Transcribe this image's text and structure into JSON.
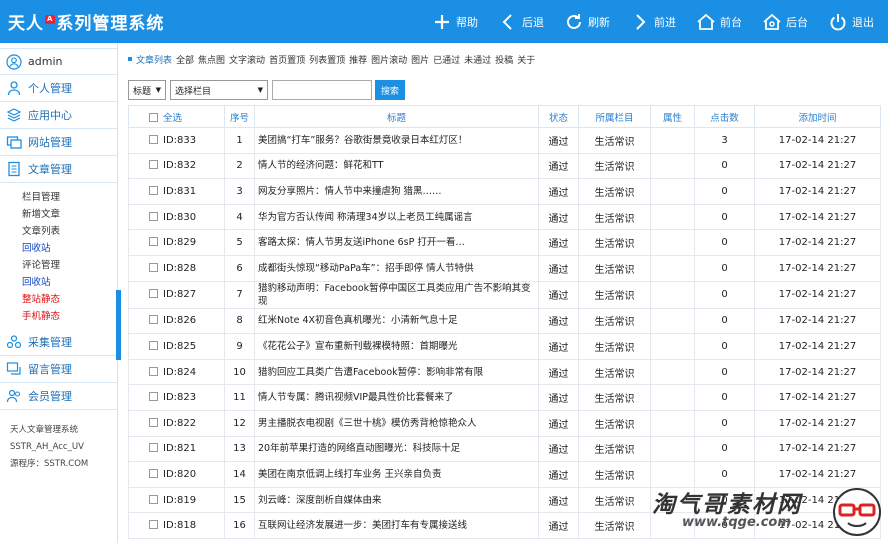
{
  "header": {
    "title": "天人系列管理系统",
    "badge": "A",
    "nav": [
      {
        "label": "帮助",
        "icon": "plus-icon"
      },
      {
        "label": "后退",
        "icon": "chevron-left-icon"
      },
      {
        "label": "刷新",
        "icon": "refresh-icon"
      },
      {
        "label": "前进",
        "icon": "chevron-right-icon"
      },
      {
        "label": "前台",
        "icon": "home-icon"
      },
      {
        "label": "后台",
        "icon": "admin-home-icon"
      },
      {
        "label": "退出",
        "icon": "power-icon"
      }
    ]
  },
  "sidebar": {
    "user": "admin",
    "groups": [
      {
        "label": "个人管理",
        "icon": "person-icon"
      },
      {
        "label": "应用中心",
        "icon": "layers-icon"
      },
      {
        "label": "网站管理",
        "icon": "windows-icon"
      },
      {
        "label": "文章管理",
        "icon": "document-icon"
      }
    ],
    "article_items": [
      {
        "label": "栏目管理",
        "color": "normal"
      },
      {
        "label": "新增文章",
        "color": "normal"
      },
      {
        "label": "文章列表",
        "color": "normal"
      },
      {
        "label": "回收站",
        "color": "blue"
      },
      {
        "label": "评论管理",
        "color": "normal"
      },
      {
        "label": "回收站",
        "color": "blue"
      },
      {
        "label": "整站静态",
        "color": "red"
      },
      {
        "label": "手机静态",
        "color": "red"
      }
    ],
    "groups2": [
      {
        "label": "采集管理",
        "icon": "collect-icon"
      },
      {
        "label": "留言管理",
        "icon": "message-icon"
      },
      {
        "label": "会员管理",
        "icon": "members-icon"
      }
    ],
    "footer": [
      "天人文章管理系统",
      "SSTR_AH_Acc_UV",
      "源程序：SSTR.COM"
    ]
  },
  "crumb": [
    "文章列表",
    "全部",
    "焦点图",
    "文字滚动",
    "首页置顶",
    "列表置顶",
    "推荐",
    "图片滚动",
    "图片",
    "已通过",
    "未通过",
    "投稿",
    "关于"
  ],
  "filters": {
    "field": "标题",
    "column": "选择栏目",
    "search_label": "搜索"
  },
  "table": {
    "headers": [
      "全选",
      "序号",
      "标题",
      "状态",
      "所属栏目",
      "属性",
      "点击数",
      "添加时间"
    ],
    "rows": [
      {
        "id": "ID:833",
        "no": "1",
        "title": "美团搞“打车”服务？谷歌街景竟收录日本红灯区！",
        "status": "通过",
        "column": "生活常识",
        "attr": "",
        "clicks": "3",
        "time": "17-02-14 21:27"
      },
      {
        "id": "ID:832",
        "no": "2",
        "title": "情人节的经济问题：鲜花和TT",
        "status": "通过",
        "column": "生活常识",
        "attr": "",
        "clicks": "0",
        "time": "17-02-14 21:27"
      },
      {
        "id": "ID:831",
        "no": "3",
        "title": "网友分享照片：情人节中来撞虐狗 猎黑……",
        "status": "通过",
        "column": "生活常识",
        "attr": "",
        "clicks": "0",
        "time": "17-02-14 21:27"
      },
      {
        "id": "ID:830",
        "no": "4",
        "title": "华为官方否认传闻 称清理34岁以上老员工纯属谣言",
        "status": "通过",
        "column": "生活常识",
        "attr": "",
        "clicks": "0",
        "time": "17-02-14 21:27"
      },
      {
        "id": "ID:829",
        "no": "5",
        "title": "客路太探：情人节男友送iPhone 6sP 打开一看…",
        "status": "通过",
        "column": "生活常识",
        "attr": "",
        "clicks": "0",
        "time": "17-02-14 21:27"
      },
      {
        "id": "ID:828",
        "no": "6",
        "title": "成都街头惊现“移动PaPa车”：招手即停 情人节特供",
        "status": "通过",
        "column": "生活常识",
        "attr": "",
        "clicks": "0",
        "time": "17-02-14 21:27"
      },
      {
        "id": "ID:827",
        "no": "7",
        "title": "猎豹移动声明：Facebook暂停中国区工具类应用广告不影响其变现",
        "status": "通过",
        "column": "生活常识",
        "attr": "",
        "clicks": "0",
        "time": "17-02-14 21:27"
      },
      {
        "id": "ID:826",
        "no": "8",
        "title": "红米Note 4X初音色真机曝光：小清新气息十足",
        "status": "通过",
        "column": "生活常识",
        "attr": "",
        "clicks": "0",
        "time": "17-02-14 21:27"
      },
      {
        "id": "ID:825",
        "no": "9",
        "title": "《花花公子》宣布重新刊载裸模特照：首期曝光",
        "status": "通过",
        "column": "生活常识",
        "attr": "",
        "clicks": "0",
        "time": "17-02-14 21:27"
      },
      {
        "id": "ID:824",
        "no": "10",
        "title": "猎豹回应工具类广告遭Facebook暂停：影响非常有限",
        "status": "通过",
        "column": "生活常识",
        "attr": "",
        "clicks": "0",
        "time": "17-02-14 21:27"
      },
      {
        "id": "ID:823",
        "no": "11",
        "title": "情人节专属：腾讯视频VIP最具性价比套餐来了",
        "status": "通过",
        "column": "生活常识",
        "attr": "",
        "clicks": "0",
        "time": "17-02-14 21:27"
      },
      {
        "id": "ID:822",
        "no": "12",
        "title": "男主播脱衣电视剧《三世十桃》模仿秀背枪惊艳众人",
        "status": "通过",
        "column": "生活常识",
        "attr": "",
        "clicks": "0",
        "time": "17-02-14 21:27"
      },
      {
        "id": "ID:821",
        "no": "13",
        "title": "20年前苹果打造的网络直动图曝光：科技际十足",
        "status": "通过",
        "column": "生活常识",
        "attr": "",
        "clicks": "0",
        "time": "17-02-14 21:27"
      },
      {
        "id": "ID:820",
        "no": "14",
        "title": "美团在南京低调上线打车业务 王兴亲自负责",
        "status": "通过",
        "column": "生活常识",
        "attr": "",
        "clicks": "0",
        "time": "17-02-14 21:27"
      },
      {
        "id": "ID:819",
        "no": "15",
        "title": "刘云峰：深度剖析自媒体由来",
        "status": "通过",
        "column": "生活常识",
        "attr": "",
        "clicks": "0",
        "time": "17-02-14 21:27"
      },
      {
        "id": "ID:818",
        "no": "16",
        "title": "互联网让经济发展进一步：美团打车有专属接送线",
        "status": "通过",
        "column": "生活常识",
        "attr": "",
        "clicks": "0",
        "time": "17-02-14 21:27"
      }
    ]
  },
  "watermark": {
    "name": "淘气哥素材网",
    "url": "www.tqge.com"
  },
  "colors": {
    "brand": "#1a8fe3",
    "link": "#1c6fb8",
    "red": "#e01010"
  }
}
